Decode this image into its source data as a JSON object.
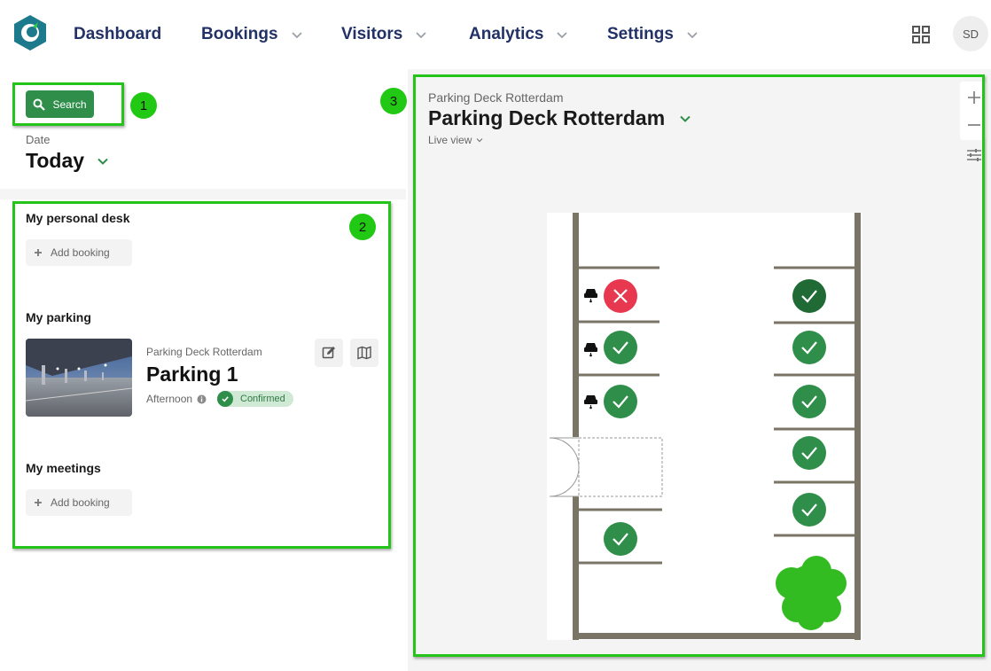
{
  "nav": {
    "items": [
      {
        "label": "Dashboard",
        "has_dropdown": false
      },
      {
        "label": "Bookings",
        "has_dropdown": true
      },
      {
        "label": "Visitors",
        "has_dropdown": true
      },
      {
        "label": "Analytics",
        "has_dropdown": true
      },
      {
        "label": "Settings",
        "has_dropdown": true
      }
    ],
    "avatar_initials": "SD",
    "icons": [
      "app-logo-icon",
      "apps-grid-icon"
    ]
  },
  "filters": {
    "search_label": "Search",
    "date_label": "Date",
    "date_value": "Today"
  },
  "sections": {
    "personal_desk": {
      "title": "My personal desk",
      "add_label": "Add booking"
    },
    "parking": {
      "title": "My parking",
      "booking": {
        "location": "Parking Deck Rotterdam",
        "name": "Parking 1",
        "time": "Afternoon",
        "status": "Confirmed"
      }
    },
    "meetings": {
      "title": "My meetings",
      "add_label": "Add booking"
    }
  },
  "map": {
    "subtitle": "Parking Deck Rotterdam",
    "title": "Parking Deck Rotterdam",
    "view_mode": "Live view",
    "spots": {
      "left_column": [
        "occupied",
        "available",
        "available",
        "available"
      ],
      "right_column": [
        "booked-by-me",
        "available",
        "available",
        "available",
        "available"
      ]
    }
  },
  "annotations": [
    "1",
    "2",
    "3"
  ],
  "colors": {
    "nav_text": "#223166",
    "primary_green": "#2f8f4a",
    "dark_green": "#1f6a35",
    "occupied_red": "#e8384f",
    "annotation_green": "#24c41a",
    "wall": "#7a7466"
  }
}
